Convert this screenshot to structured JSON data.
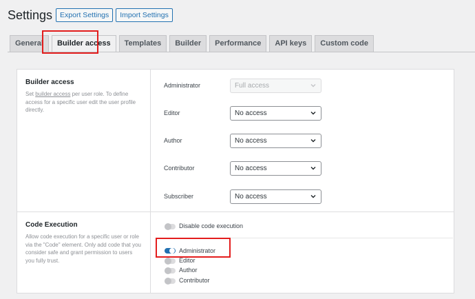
{
  "header": {
    "title": "Settings",
    "export_label": "Export Settings",
    "import_label": "Import Settings"
  },
  "tabs": [
    {
      "label": "General"
    },
    {
      "label": "Builder access"
    },
    {
      "label": "Templates"
    },
    {
      "label": "Builder"
    },
    {
      "label": "Performance"
    },
    {
      "label": "API keys"
    },
    {
      "label": "Custom code"
    }
  ],
  "active_tab": "Builder access",
  "builder_access": {
    "title": "Builder access",
    "desc_prefix": "Set ",
    "desc_link": "builder access",
    "desc_suffix": " per user role. To define access for a specific user edit the user profile directly.",
    "roles": [
      {
        "label": "Administrator",
        "value": "Full access",
        "disabled": true
      },
      {
        "label": "Editor",
        "value": "No access"
      },
      {
        "label": "Author",
        "value": "No access"
      },
      {
        "label": "Contributor",
        "value": "No access"
      },
      {
        "label": "Subscriber",
        "value": "No access"
      }
    ]
  },
  "code_execution": {
    "title": "Code Execution",
    "desc": "Allow code execution for a specific user or role via the \"Code\" element. Only add code that you consider safe and grant permission to users you fully trust.",
    "disable_label": "Disable code execution",
    "roles": [
      {
        "label": "Administrator",
        "enabled": true
      },
      {
        "label": "Editor",
        "enabled": false
      },
      {
        "label": "Author",
        "enabled": false
      },
      {
        "label": "Contributor",
        "enabled": false
      }
    ]
  },
  "colors": {
    "accent": "#2271b1",
    "highlight": "#e31c1c"
  }
}
